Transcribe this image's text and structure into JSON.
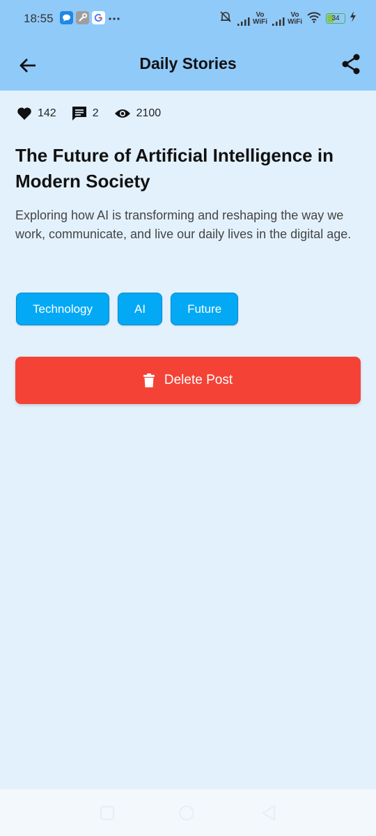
{
  "status_bar": {
    "time": "18:55",
    "vowifi_top": "Vo",
    "vowifi_bottom": "WiFi",
    "battery": "34"
  },
  "app_bar": {
    "title": "Daily Stories"
  },
  "stats": {
    "likes": "142",
    "comments": "2",
    "views": "2100"
  },
  "post": {
    "title": "The Future of Artificial Intelligence in Modern Society",
    "description": "Exploring how AI is transforming and reshaping the way we work, communicate, and live our daily lives in the digital age."
  },
  "tags": [
    "Technology",
    "AI",
    "Future"
  ],
  "delete_label": "Delete Post",
  "colors": {
    "app_bar": "#90caf9",
    "background": "#e3f1fd",
    "tag": "#03a9f4",
    "delete": "#f44336"
  },
  "icons": {
    "back": "arrow-left-icon",
    "share": "share-icon",
    "likes": "heart-icon",
    "comments": "comment-icon",
    "views": "eye-icon",
    "delete": "trash-icon"
  }
}
